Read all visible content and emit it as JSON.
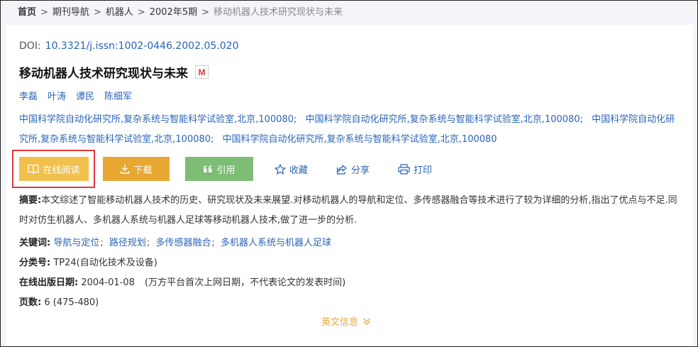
{
  "breadcrumb": {
    "home": "首页",
    "items": [
      "期刊导航",
      "机器人",
      "2002年5期"
    ],
    "current": "移动机器人技术研究现状与未来",
    "separator": ">"
  },
  "article": {
    "doi_label": "DOI:",
    "doi": "10.3321/j.issn:1002-0446.2002.05.020",
    "title": "移动机器人技术研究现状与未来",
    "badge": "M",
    "authors": [
      "李磊",
      "叶涛",
      "谭民",
      "陈细军"
    ],
    "affiliations": [
      "中国科学院自动化研究所,复杂系统与智能科学试验室,北京,100080;",
      "中国科学院自动化研究所,复杂系统与智能科学试验室,北京,100080;",
      "中国科学院自动化研究所,复杂系统与智能科学试验室,北京,100080;",
      "中国科学院自动化研究所,复杂系统与智能科学试验室,北京,100080"
    ]
  },
  "actions": {
    "read": "在线阅读",
    "download": "下载",
    "cite": "引用",
    "favorite": "收藏",
    "share": "分享",
    "print": "打印"
  },
  "abstract": {
    "label": "摘要:",
    "text": "本文综述了智能移动机器人技术的历史、研究现状及未来展望.对移动机器人的导航和定位、多传感器融合等技术进行了较为详细的分析,指出了优点与不足.同时对仿生机器人、多机器人系统与机器人足球等移动机器人技术,做了进一步的分析."
  },
  "keywords": {
    "label": "关键词:",
    "items": [
      "导航与定位",
      "路径规划",
      "多传感器融合",
      "多机器人系统与机器人足球"
    ],
    "separator": ";"
  },
  "classification": {
    "label": "分类号:",
    "value": "TP24(自动化技术及设备)"
  },
  "online_date": {
    "label": "在线出版日期:",
    "value": "2004-01-08",
    "note": "(万方平台首次上网日期，不代表论文的发表时间)"
  },
  "pages": {
    "label": "页数:",
    "value": "6 (475-480)"
  },
  "more": {
    "label": "英文信息"
  },
  "colors": {
    "link": "#2a64b7",
    "read_button": "#f2c04d",
    "download_button": "#e8a733",
    "cite_button": "#7dbd76",
    "highlight_outline": "#e03a3a"
  }
}
